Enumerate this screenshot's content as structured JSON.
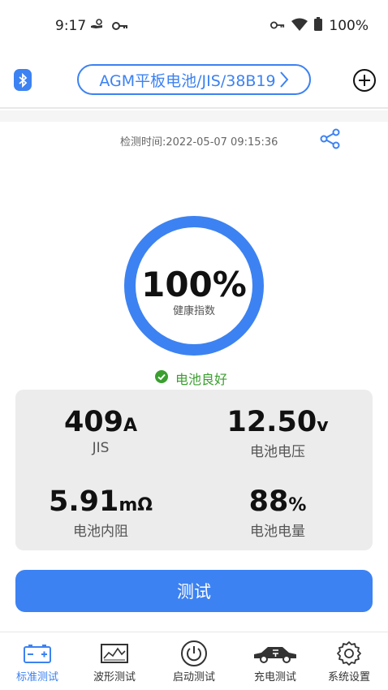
{
  "status_bar": {
    "time": "9:17",
    "battery": "100%"
  },
  "header": {
    "battery_type": "AGM平板电池/JIS/38B19"
  },
  "result": {
    "test_time": "检测时间:2022-05-07 09:15:36",
    "health_value": "100%",
    "health_label": "健康指数",
    "health_fraction": 1.0,
    "status_text": "电池良好"
  },
  "metrics": {
    "cca_value": "409",
    "cca_unit": "A",
    "cca_label": "JIS",
    "voltage_value": "12.50",
    "voltage_unit": "v",
    "voltage_label": "电池电压",
    "resistance_value": "5.91",
    "resistance_unit": "mΩ",
    "resistance_label": "电池内阻",
    "soc_value": "88",
    "soc_unit": "%",
    "soc_label": "电池电量"
  },
  "actions": {
    "test_label": "测试"
  },
  "nav": [
    {
      "label": "标准测试",
      "icon": "battery-icon",
      "active": true
    },
    {
      "label": "波形测试",
      "icon": "waveform-icon",
      "active": false
    },
    {
      "label": "启动测试",
      "icon": "power-icon",
      "active": false
    },
    {
      "label": "充电测试",
      "icon": "car-charge-icon",
      "active": false
    },
    {
      "label": "系统设置",
      "icon": "gear-icon",
      "active": false
    }
  ],
  "colors": {
    "accent": "#3c82f2",
    "ok": "#3a9f2f"
  }
}
